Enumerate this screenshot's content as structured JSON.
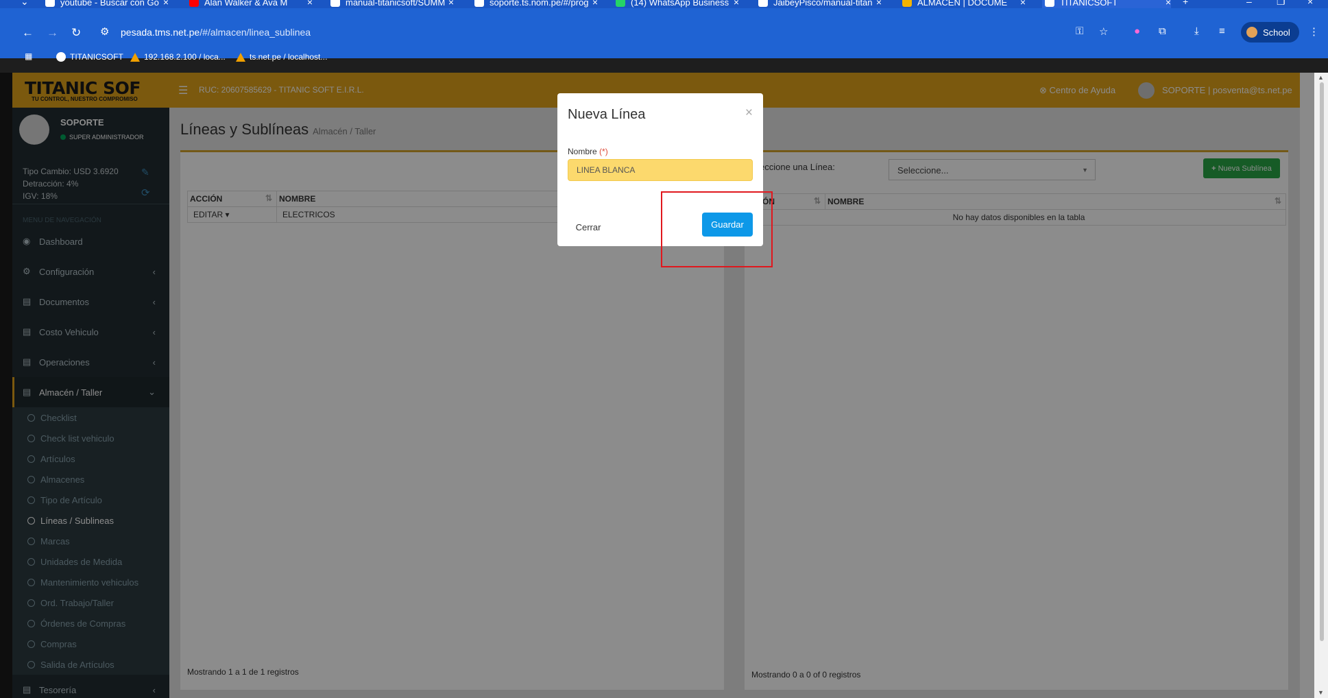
{
  "browser": {
    "tabs": [
      {
        "label": "youtube - Buscar con Go",
        "favicon": "google-icon"
      },
      {
        "label": "Alan Walker & Ava M",
        "favicon": "youtube-icon"
      },
      {
        "label": "manual-titanicsoft/SUMM",
        "favicon": "github-icon"
      },
      {
        "label": "soporte.ts.nom.pe/#/prog",
        "favicon": "globe-icon"
      },
      {
        "label": "(14) WhatsApp Business",
        "favicon": "whatsapp-icon"
      },
      {
        "label": "JaibeyPisco/manual-titan",
        "favicon": "github-icon"
      },
      {
        "label": "ALMACEN | DOCUME",
        "favicon": "docs-icon"
      },
      {
        "label": "TITANICSOFT",
        "favicon": "globe-icon"
      }
    ],
    "url_host": "pesada.tms.net.pe",
    "url_path": "/#/almacen/linea_sublinea",
    "profile_label": "School",
    "bookmarks": [
      "TITANICSOFT",
      "192.168.2.100 / loca...",
      "ts.net.pe / localhost..."
    ]
  },
  "app": {
    "logo": "TITANIC SOF",
    "logo_tagline": "TU CONTROL, NUESTRO COMPROMISO",
    "ruc": "RUC: 20607585629 - TITANIC SOFT E.I.R.L.",
    "help": "Centro de Ayuda",
    "user": "SOPORTE | posventa@ts.net.pe",
    "accent_color": "#e0a21a"
  },
  "sidebar": {
    "user_name": "SOPORTE",
    "user_role": "SUPER ADMINISTRADOR",
    "tipo_cambio": "Tipo Cambio: USD 3.6920",
    "detraccion": "Detracción: 4%",
    "igv": "IGV: 18%",
    "menu_header": "MENU DE NAVEGACIÓN",
    "items": [
      {
        "label": "Dashboard",
        "icon": "dashboard-icon"
      },
      {
        "label": "Configuración",
        "icon": "cogs-icon"
      },
      {
        "label": "Documentos",
        "icon": "document-icon"
      },
      {
        "label": "Costo Vehiculo",
        "icon": "document-icon"
      },
      {
        "label": "Operaciones",
        "icon": "document-icon"
      },
      {
        "label": "Almacén / Taller",
        "icon": "document-icon"
      }
    ],
    "subitems": [
      "Checklist",
      "Check list vehiculo",
      "Artículos",
      "Almacenes",
      "Tipo de Artículo",
      "Líneas / Sublineas",
      "Marcas",
      "Unidades de Medida",
      "Mantenimiento vehiculos",
      "Ord. Trabajo/Taller",
      "Órdenes de Compras",
      "Compras",
      "Salida de Artículos"
    ],
    "next_item": "Tesorería"
  },
  "content": {
    "title": "Líneas y Sublíneas",
    "breadcrumb": "Almacén / Taller",
    "lineas_table": {
      "headers": [
        "ACCIÓN",
        "NOMBRE"
      ],
      "rows": [
        {
          "action": "EDITAR",
          "nombre": "ELECTRICOS"
        }
      ],
      "footer": "Mostrando 1 a 1 de 1 registros"
    },
    "sublineas": {
      "select_label": "eccione una Línea:",
      "select_value": "Seleccione...",
      "new_button": "Nueva Sublínea",
      "headers": [
        "CIÓN",
        "NOMBRE"
      ],
      "empty": "No hay datos disponibles en la tabla",
      "footer": "Mostrando 0 a 0 of 0 registros"
    }
  },
  "modal": {
    "title": "Nueva Línea",
    "close": "×",
    "label": "Nombre",
    "required_mark": "(*)",
    "input_value": "LINEA BLANCA",
    "cancel": "Cerrar",
    "save": "Guardar"
  }
}
